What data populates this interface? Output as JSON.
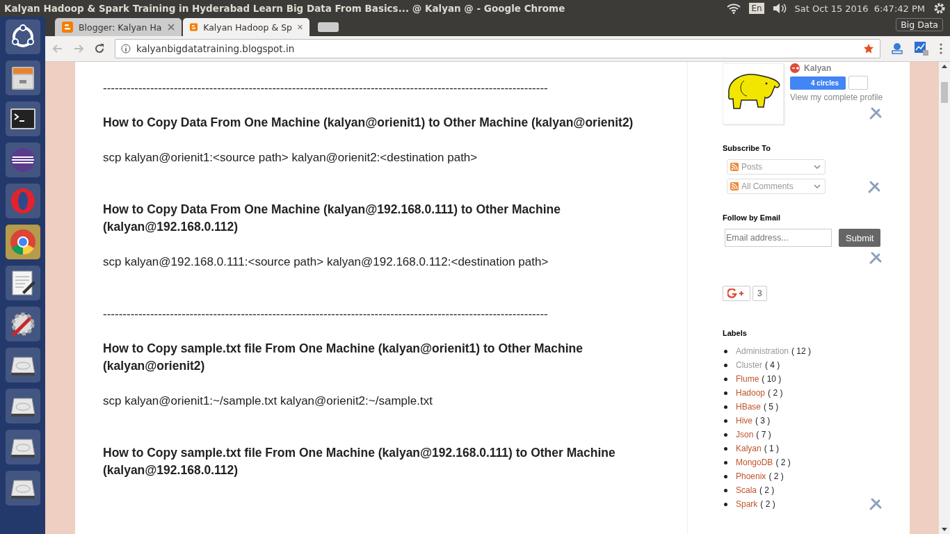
{
  "top_panel": {
    "title": "Kalyan Hadoop & Spark Training in Hyderabad Learn Big Data From Basics... @ Kalyan @ - Google Chrome",
    "language": "En",
    "clock": "Sat Oct 15 2016  6:47:42 PM",
    "tooltip": "Big Data"
  },
  "launcher": [
    {
      "kind": "ubuntu",
      "selected": false
    },
    {
      "kind": "files",
      "selected": false
    },
    {
      "kind": "terminal",
      "selected": false
    },
    {
      "kind": "eclipse",
      "selected": false
    },
    {
      "kind": "opera",
      "selected": false
    },
    {
      "kind": "chrome",
      "selected": true
    },
    {
      "kind": "editor",
      "selected": false
    },
    {
      "kind": "settings",
      "selected": false
    },
    {
      "kind": "drive",
      "selected": false
    },
    {
      "kind": "drive",
      "selected": false
    },
    {
      "kind": "drive",
      "selected": false
    },
    {
      "kind": "drive",
      "selected": false
    }
  ],
  "tabs": [
    {
      "title": "Blogger: Kalyan Ha",
      "selected": false
    },
    {
      "title": "Kalyan Hadoop & Sp",
      "selected": true
    }
  ],
  "address": "kalyanbigdatatraining.blogspot.in",
  "post": [
    {
      "kind": "separator",
      "text": "-----------------------------------------------------------------------------------------------------------------"
    },
    {
      "kind": "heading",
      "text": "How to Copy Data From One Machine (kalyan@orienit1) to Other Machine (kalyan@orienit2)"
    },
    {
      "kind": "command",
      "text": "scp kalyan@orienit1:<source path> kalyan@orienit2:<destination path>"
    },
    {
      "kind": "heading",
      "text": "How to Copy Data From One Machine (kalyan@192.168.0.111) to Other Machine (kalyan@192.168.0.112)"
    },
    {
      "kind": "command",
      "text": "scp kalyan@192.168.0.111:<source path> kalyan@192.168.0.112:<destination path>"
    },
    {
      "kind": "separator",
      "text": "-----------------------------------------------------------------------------------------------------------------"
    },
    {
      "kind": "heading",
      "text": "How to Copy sample.txt file From One Machine (kalyan@orienit1) to Other Machine (kalyan@orienit2)"
    },
    {
      "kind": "command",
      "text": "scp kalyan@orienit1:~/sample.txt kalyan@orienit2:~/sample.txt"
    },
    {
      "kind": "heading",
      "text": "How to Copy sample.txt file From One Machine (kalyan@192.168.0.111) to Other Machine (kalyan@192.168.0.112)"
    }
  ],
  "profile": {
    "name": "Kalyan",
    "circles": "4 circles",
    "link": "View my complete profile"
  },
  "subscribe": {
    "title": "Subscribe To",
    "options": [
      "Posts",
      "All Comments"
    ]
  },
  "follow": {
    "title": "Follow by Email",
    "placeholder": "Email address...",
    "button": "Submit"
  },
  "plus_one": {
    "count": "3"
  },
  "labels": {
    "title": "Labels",
    "items": [
      {
        "name": "Administration",
        "count": "( 12 )",
        "visited": true
      },
      {
        "name": "Cluster",
        "count": "( 4 )",
        "visited": true
      },
      {
        "name": "Flume",
        "count": "( 10 )",
        "visited": false
      },
      {
        "name": "Hadoop",
        "count": "( 2 )",
        "visited": false
      },
      {
        "name": "HBase",
        "count": "( 5 )",
        "visited": false
      },
      {
        "name": "Hive",
        "count": "( 3 )",
        "visited": false
      },
      {
        "name": "Json",
        "count": "( 7 )",
        "visited": false
      },
      {
        "name": "Kalyan",
        "count": "( 1 )",
        "visited": false
      },
      {
        "name": "MongoDB",
        "count": "( 2 )",
        "visited": false
      },
      {
        "name": "Phoenix",
        "count": "( 2 )",
        "visited": false
      },
      {
        "name": "Scala",
        "count": "( 2 )",
        "visited": false
      },
      {
        "name": "Spark",
        "count": "( 2 )",
        "visited": false
      }
    ]
  }
}
